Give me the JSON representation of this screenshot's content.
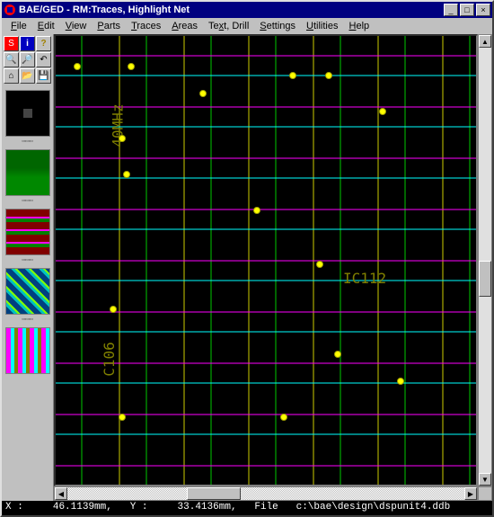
{
  "window": {
    "title": "BAE/GED - RM:Traces, Highlight Net"
  },
  "menu": {
    "file": "File",
    "edit": "Edit",
    "view": "View",
    "parts": "Parts",
    "traces": "Traces",
    "areas": "Areas",
    "textdrill": "Text, Drill",
    "settings": "Settings",
    "utilities": "Utilities",
    "help": "Help"
  },
  "toolbar": {
    "red_s": "S",
    "info": "i",
    "help": "?",
    "zoomin": "+",
    "zoomout": "-",
    "back": "↶",
    "home": "⌂",
    "open": "📂",
    "save": "💾"
  },
  "status": {
    "x_label": "X :",
    "x_val": "46.1139mm,",
    "y_label": "Y :",
    "y_val": "33.4136mm,",
    "file_label": "File",
    "file_val": "c:\\bae\\design\\dspunit4.ddb"
  },
  "pcb_labels": {
    "xtal": "40MHz",
    "ic": "IC112",
    "c": "C106"
  }
}
